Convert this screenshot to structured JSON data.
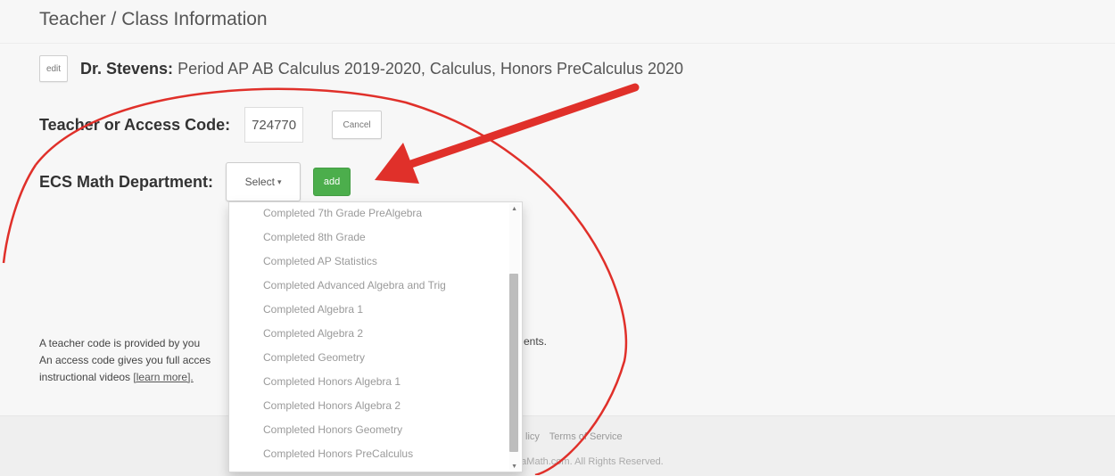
{
  "section": {
    "title": "Teacher / Class Information"
  },
  "class_info": {
    "edit_label": "edit",
    "teacher": "Dr. Stevens:",
    "classes": "Period AP AB Calculus 2019-2020, Calculus, Honors PreCalculus 2020"
  },
  "code": {
    "label": "Teacher or Access Code:",
    "value": "724770",
    "cancel_label": "Cancel"
  },
  "department": {
    "label": "ECS Math Department:",
    "select_label": "Select",
    "add_label": "add",
    "options": [
      "Completed 7th Grade PreAlgebra",
      "Completed 8th Grade",
      "Completed AP Statistics",
      "Completed Advanced Algebra and Trig",
      "Completed Algebra 1",
      "Completed Algebra 2",
      "Completed Geometry",
      "Completed Honors Algebra 1",
      "Completed Honors Algebra 2",
      "Completed Honors Geometry",
      "Completed Honors PreCalculus"
    ]
  },
  "help": {
    "line1": "A teacher code is provided by you",
    "line1_end": "ents.",
    "line2": "An access code gives you full acces",
    "line3": "instructional videos",
    "learn_more": "[learn more]."
  },
  "footer": {
    "links": [
      "licy",
      "Terms of Service"
    ],
    "copyright": "thaMath.com. All Rights Reserved."
  },
  "annotation": {
    "color": "#e0302a"
  }
}
